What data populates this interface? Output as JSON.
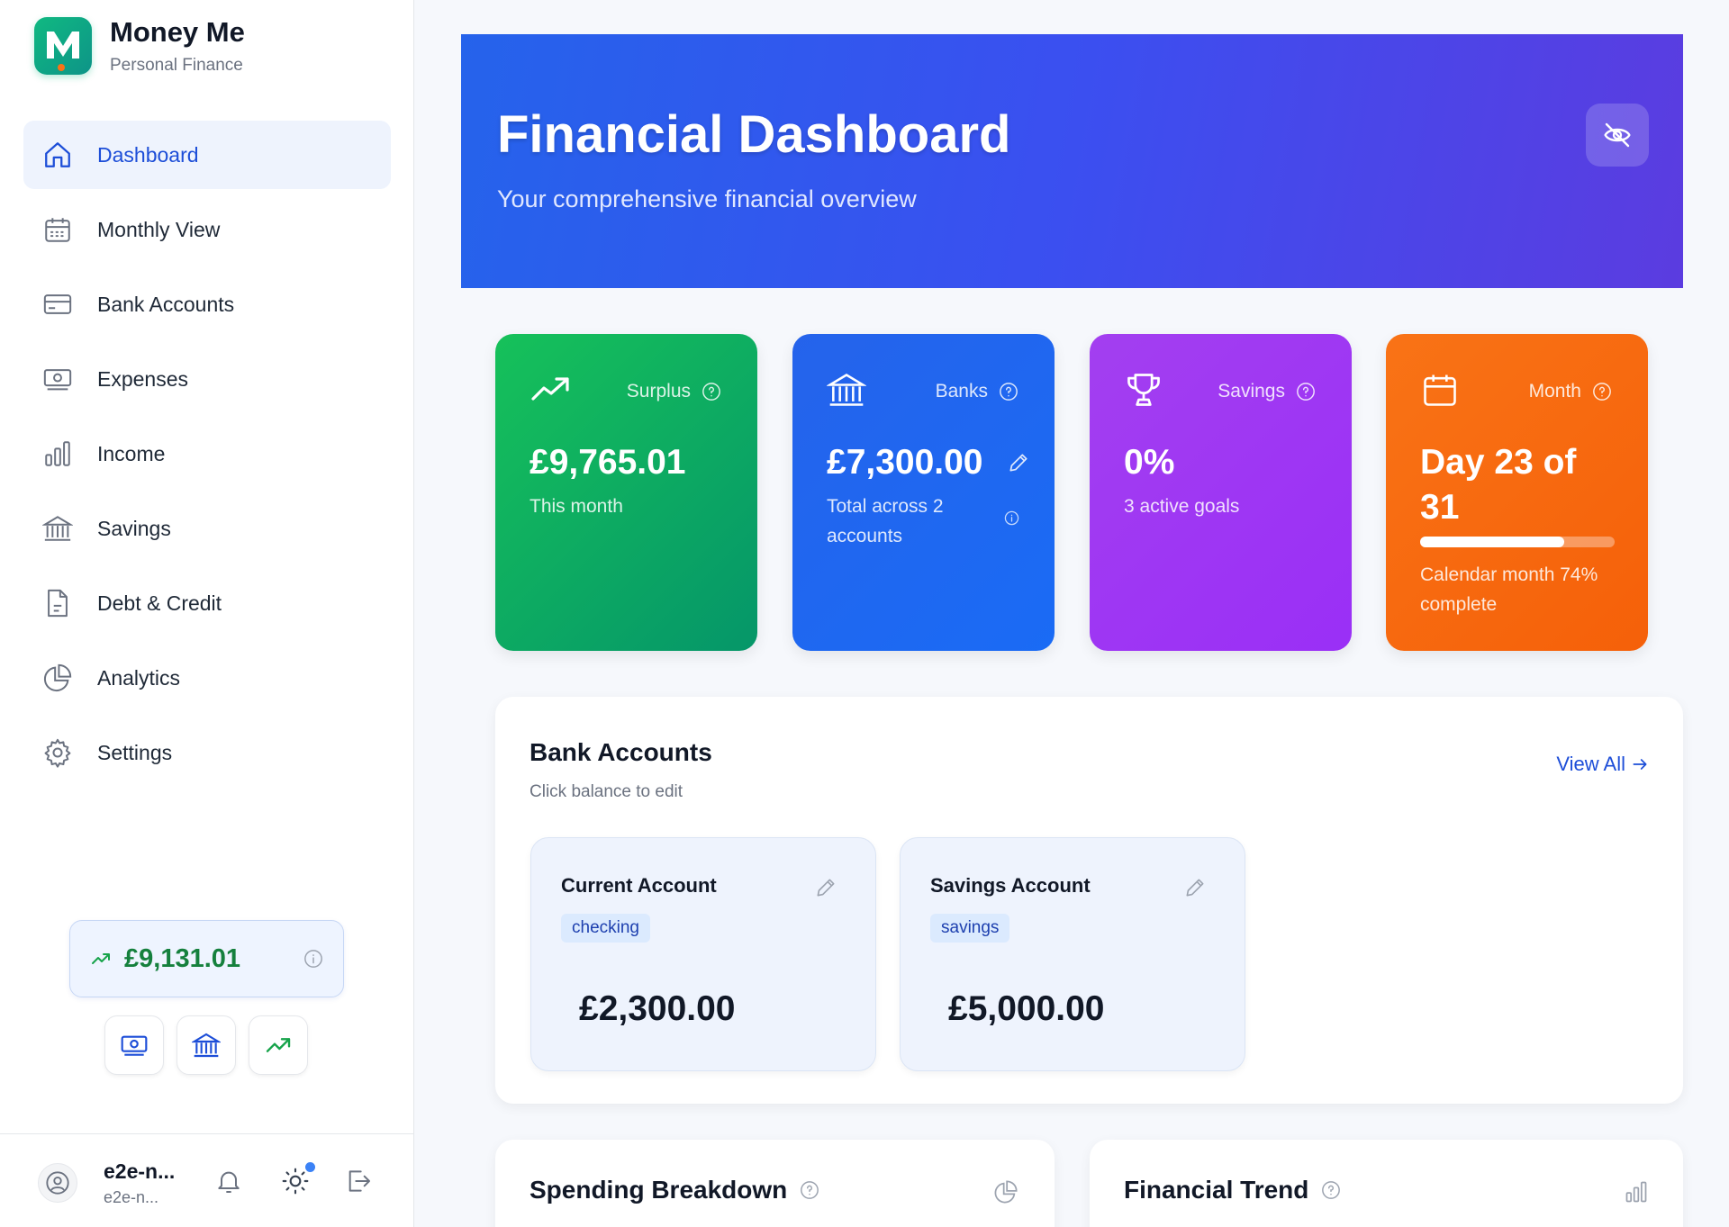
{
  "app": {
    "name": "Money Me",
    "subtitle": "Personal Finance"
  },
  "nav": [
    {
      "label": "Dashboard",
      "icon": "home-icon",
      "active": true
    },
    {
      "label": "Monthly View",
      "icon": "calendar-icon"
    },
    {
      "label": "Bank Accounts",
      "icon": "credit-card-icon"
    },
    {
      "label": "Expenses",
      "icon": "banknote-icon"
    },
    {
      "label": "Income",
      "icon": "bar-chart-icon"
    },
    {
      "label": "Savings",
      "icon": "bank-icon"
    },
    {
      "label": "Debt & Credit",
      "icon": "document-icon"
    },
    {
      "label": "Analytics",
      "icon": "pie-chart-icon"
    },
    {
      "label": "Settings",
      "icon": "gear-icon"
    }
  ],
  "sidebar_balance": "£9,131.01",
  "user": {
    "name": "e2e-n...",
    "email": "e2e-n..."
  },
  "hero": {
    "title": "Financial Dashboard",
    "subtitle": "Your comprehensive financial overview"
  },
  "stats": {
    "surplus": {
      "label": "Surplus",
      "value": "£9,765.01",
      "desc": "This month"
    },
    "banks": {
      "label": "Banks",
      "value": "£7,300.00",
      "desc": "Total across 2 accounts"
    },
    "savings": {
      "label": "Savings",
      "value": "0%",
      "desc": "3 active goals"
    },
    "month": {
      "label": "Month",
      "value": "Day 23 of 31",
      "desc": "Calendar month 74% complete",
      "progress": 0.74
    }
  },
  "bank_panel": {
    "title": "Bank Accounts",
    "subtitle": "Click balance to edit",
    "view_all": "View All",
    "accounts": [
      {
        "name": "Current Account",
        "type": "checking",
        "balance": "£2,300.00"
      },
      {
        "name": "Savings Account",
        "type": "savings",
        "balance": "£5,000.00"
      }
    ]
  },
  "spending": {
    "title": "Spending Breakdown"
  },
  "trend": {
    "title": "Financial Trend"
  },
  "colors": {
    "accent": "#1d4ed8",
    "positive": "#15803d",
    "surplus": "#16c15a",
    "banks": "#2563eb",
    "savings": "#a33ff0",
    "month": "#f97316"
  }
}
